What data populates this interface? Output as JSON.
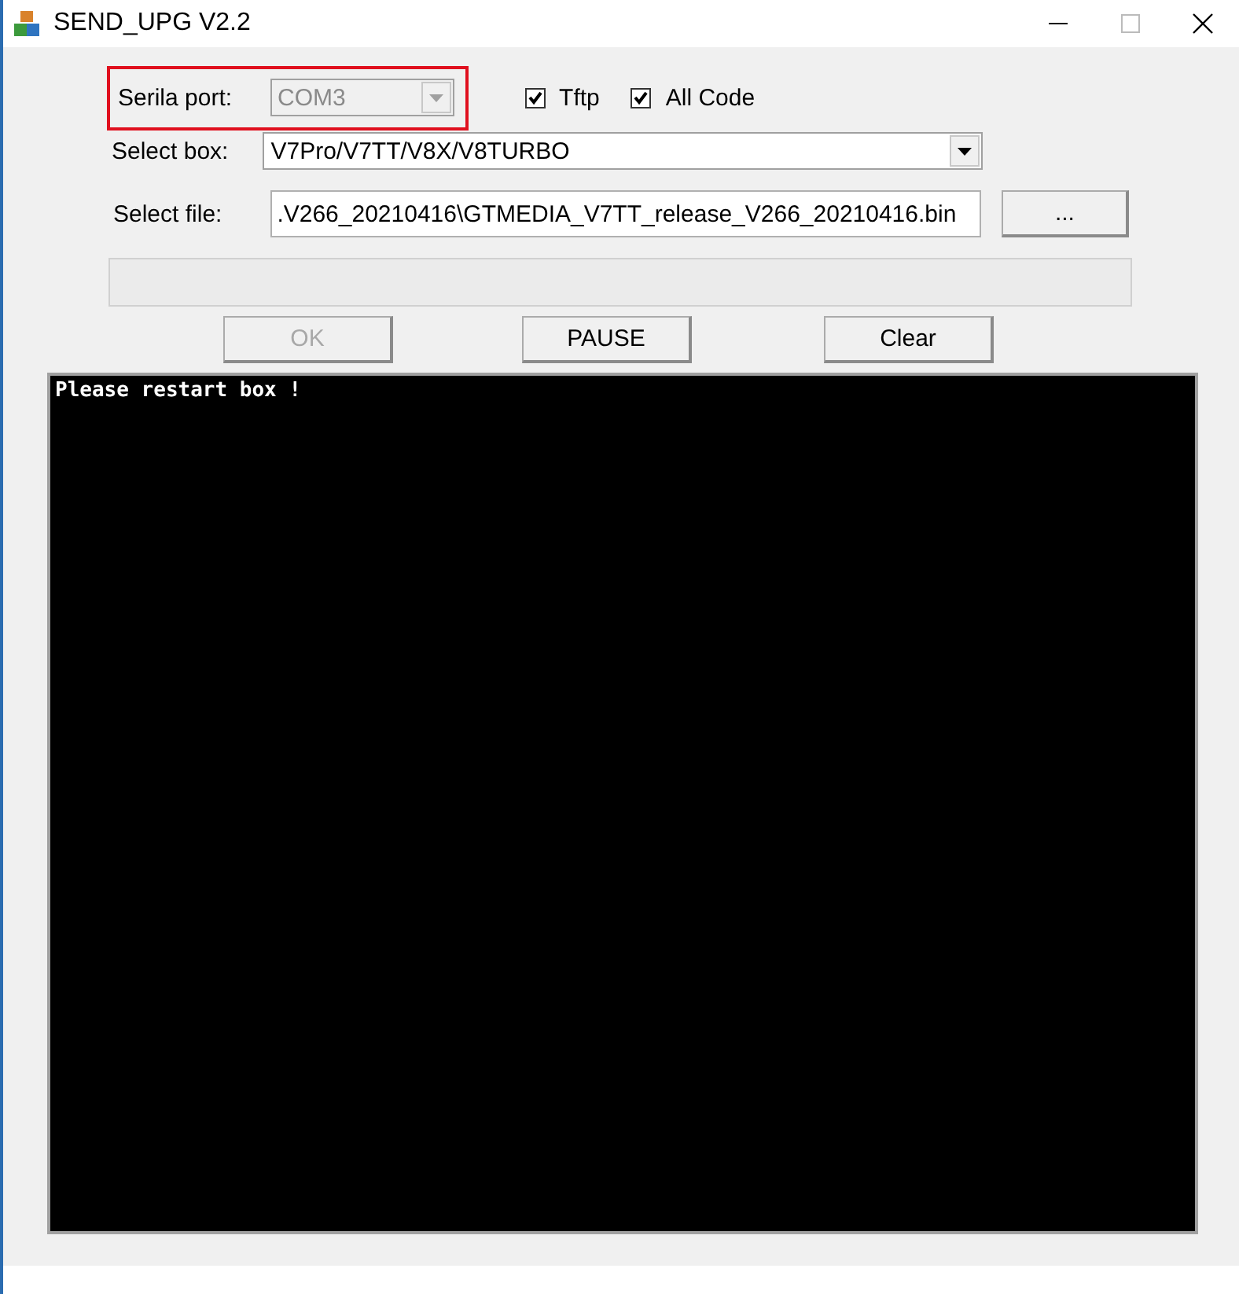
{
  "window": {
    "title": "SEND_UPG V2.2"
  },
  "serial_port": {
    "label": "Serila port:",
    "value": "COM3",
    "disabled": true,
    "highlighted": true
  },
  "options": [
    {
      "label": "Tftp",
      "checked": true
    },
    {
      "label": "All Code",
      "checked": true
    }
  ],
  "select_box": {
    "label": "Select box:",
    "value": "V7Pro/V7TT/V8X/V8TURBO"
  },
  "select_file": {
    "label": "Select file:",
    "value": ".V266_20210416\\GTMEDIA_V7TT_release_V266_20210416.bin",
    "browse": "..."
  },
  "progress": {
    "level": 0
  },
  "buttons": [
    {
      "label": "OK",
      "disabled": true
    },
    {
      "label": "PAUSE",
      "disabled": false
    },
    {
      "label": "Clear",
      "disabled": false
    }
  ],
  "console": {
    "lines": [
      "Please restart box !"
    ]
  }
}
